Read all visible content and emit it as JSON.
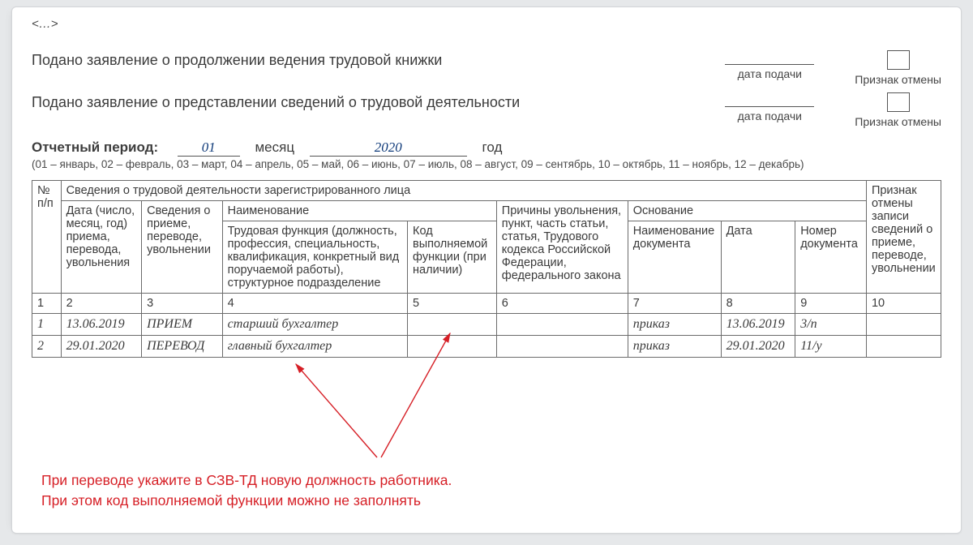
{
  "top_ellipsis": "<…>",
  "statement1": "Подано заявление о продолжении ведения трудовой книжки",
  "statement2": "Подано заявление о представлении сведений о трудовой деятельности",
  "lab_date": "дата подачи",
  "lab_flag": "Признак отмены",
  "period": {
    "title": "Отчетный период:",
    "month_val": "01",
    "month_lab": "месяц",
    "year_val": "2020",
    "year_lab": "год",
    "note": "(01 – январь, 02 – февраль, 03 – март, 04 – апрель, 05 – май, 06 – июнь, 07 – июль, 08 – август, 09 – сентябрь, 10 – октябрь, 11 – ноябрь, 12 – декабрь)"
  },
  "headers": {
    "num": "№ п/п",
    "supergroup": "Сведения о трудовой деятельности зарегистрированного лица",
    "date": "Дата (число, месяц, год) приема, перевода, увольнения",
    "info": "Сведения о приеме, переводе, увольнении",
    "name_group": "Наименование",
    "func": "Трудовая функция (должность, профессия, специальность, квалификация, конкретный вид поручаемой работы), структурное подразделение",
    "code": "Код выполняемой функции (при наличии)",
    "cause": "Причины увольнения, пункт, часть статьи, статья, Трудового кодекса Российской Федерации, федерального закона",
    "base_group": "Основание",
    "doc": "Наименование документа",
    "ddate": "Дата",
    "dnum": "Номер документа",
    "flag": "Признак отмены записи сведений о приеме, переводе, увольнении"
  },
  "colnums": [
    "1",
    "2",
    "3",
    "4",
    "5",
    "6",
    "7",
    "8",
    "9",
    "10"
  ],
  "rows": [
    {
      "n": "1",
      "date": "13.06.2019",
      "info": "ПРИЕМ",
      "func": "старший бухгалтер",
      "code": "",
      "cause": "",
      "doc": "приказ",
      "ddate": "13.06.2019",
      "dnum": "3/п",
      "flag": ""
    },
    {
      "n": "2",
      "date": "29.01.2020",
      "info": "ПЕРЕВОД",
      "func": "главный бухгалтер",
      "code": "",
      "cause": "",
      "doc": "приказ",
      "ddate": "29.01.2020",
      "dnum": "11/у",
      "flag": ""
    }
  ],
  "note": {
    "l1": "При переводе укажите в СЗВ-ТД новую должность работника.",
    "l2": "При этом код выполняемой функции можно не заполнять"
  }
}
